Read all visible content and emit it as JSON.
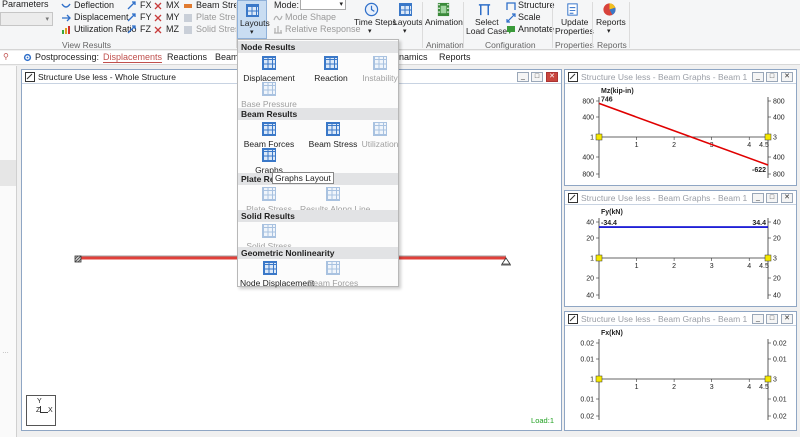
{
  "ribbon": {
    "params_label": "Parameters",
    "view_results": {
      "items": [
        "Deflection",
        "Displacement",
        "Utilization Ratio"
      ],
      "forces_col1": [
        "FX",
        "FY",
        "FZ"
      ],
      "forces_col2": [
        "MX",
        "MY",
        "MZ"
      ],
      "stress": [
        "Beam Stress",
        "Plate Stress",
        "Solid Stress"
      ],
      "group_label": "View Results"
    },
    "layouts_label": "Layouts",
    "mode_label": "Mode:",
    "mode_shape": "Mode Shape",
    "relative_response": "Relative Response",
    "time_steps_label": "Time Steps",
    "layouts2_label": "Layouts",
    "animation_label": "Animation",
    "animation_group": "Animation",
    "select_load_case": [
      "Select",
      "Load Case"
    ],
    "structure_label": "Structure",
    "scale_label": "Scale",
    "annotate_label": "Annotate",
    "configuration_group": "Configuration",
    "update_properties": [
      "Update",
      "Properties"
    ],
    "properties_group": "Properties",
    "reports_label": "Reports",
    "reports_group": "Reports"
  },
  "postbar": {
    "label": "Postprocessing:",
    "tabs": [
      "Displacements",
      "Reactions",
      "Beam R",
      "namics",
      "Reports"
    ]
  },
  "main_window": {
    "title": "Structure Use less - Whole Structure",
    "load_label": "Load:1",
    "axis_y": "Y",
    "axis_z": "Z",
    "axis_x": "X"
  },
  "graph1": {
    "title": "Structure Use less - Beam Graphs - Beam 1",
    "label": "Mz(kip-in)",
    "start_value": "746",
    "end_value": "-622",
    "yticks_left": [
      "800",
      "400",
      "1",
      "400",
      "800"
    ],
    "yticks_right": [
      "800",
      "400",
      "3",
      "400",
      "800"
    ],
    "xticks": [
      "1",
      "2",
      "3",
      "4",
      "4.5"
    ]
  },
  "graph2": {
    "title": "Structure Use less - Beam Graphs - Beam 1",
    "label": "Fy(kN)",
    "start_value": "-34.4",
    "end_value": "34.4",
    "yticks_left": [
      "40",
      "20",
      "1",
      "20",
      "40"
    ],
    "yticks_right": [
      "40",
      "20",
      "3",
      "20",
      "40"
    ],
    "xticks": [
      "1",
      "2",
      "3",
      "4",
      "4.5"
    ]
  },
  "graph3": {
    "title": "Structure Use less - Beam Graphs - Beam 1",
    "label": "Fx(kN)",
    "yticks_left": [
      "0.02",
      "0.01",
      "1",
      "0.01",
      "0.02"
    ],
    "yticks_right": [
      "0.02",
      "0.01",
      "3",
      "0.01",
      "0.02"
    ],
    "xticks": [
      "1",
      "2",
      "3",
      "4",
      "4.5"
    ]
  },
  "dropdown": {
    "node_results": "Node Results",
    "displacement": "Displacement",
    "reaction": "Reaction",
    "instability": "Instability",
    "base_pressure": "Base Pressure",
    "beam_results": "Beam Results",
    "beam_forces": "Beam Forces",
    "beam_stress": "Beam Stress",
    "utilization": "Utilization",
    "graphs": "Graphs",
    "plate_results": "Plate Res",
    "plate_stress": "Plate Stress",
    "results_along_line": "Results Along Line",
    "solid_results": "Solid Results",
    "solid_stress": "Solid Stress",
    "geometric_nonlinearity": "Geometric Nonlinearity",
    "node_displacement": "Node Displacement",
    "beam_forces2": "Beam Forces",
    "tooltip": "Graphs Layout"
  },
  "colors": {
    "accent": "#c0504d",
    "beam": "#e0403a",
    "moment": "#e00000",
    "shear": "#0000d0"
  }
}
